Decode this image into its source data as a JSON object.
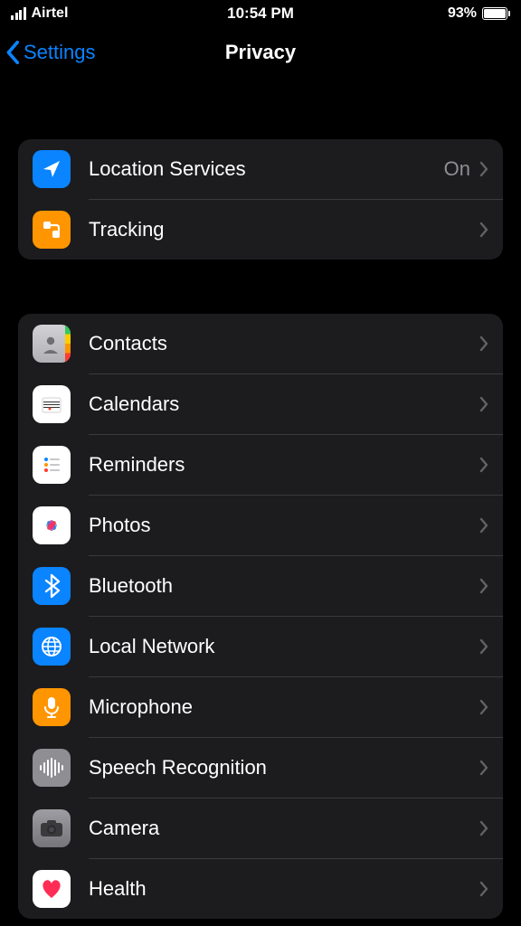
{
  "status": {
    "carrier": "Airtel",
    "time": "10:54 PM",
    "battery_pct": "93%"
  },
  "nav": {
    "back_label": "Settings",
    "title": "Privacy"
  },
  "group1": [
    {
      "label": "Location Services",
      "detail": "On",
      "icon": "location-arrow",
      "bg": "bg-blue"
    },
    {
      "label": "Tracking",
      "detail": "",
      "icon": "tracking",
      "bg": "bg-orange"
    }
  ],
  "group2": [
    {
      "label": "Contacts",
      "icon": "contacts",
      "bg": "bg-contacts"
    },
    {
      "label": "Calendars",
      "icon": "calendar",
      "bg": "bg-white"
    },
    {
      "label": "Reminders",
      "icon": "reminders",
      "bg": "bg-white"
    },
    {
      "label": "Photos",
      "icon": "photos",
      "bg": "bg-white"
    },
    {
      "label": "Bluetooth",
      "icon": "bluetooth",
      "bg": "bg-blue"
    },
    {
      "label": "Local Network",
      "icon": "globe",
      "bg": "bg-blue"
    },
    {
      "label": "Microphone",
      "icon": "microphone",
      "bg": "bg-orange"
    },
    {
      "label": "Speech Recognition",
      "icon": "waveform",
      "bg": "bg-gray"
    },
    {
      "label": "Camera",
      "icon": "camera",
      "bg": "bg-camera"
    },
    {
      "label": "Health",
      "icon": "heart",
      "bg": "bg-white"
    }
  ]
}
